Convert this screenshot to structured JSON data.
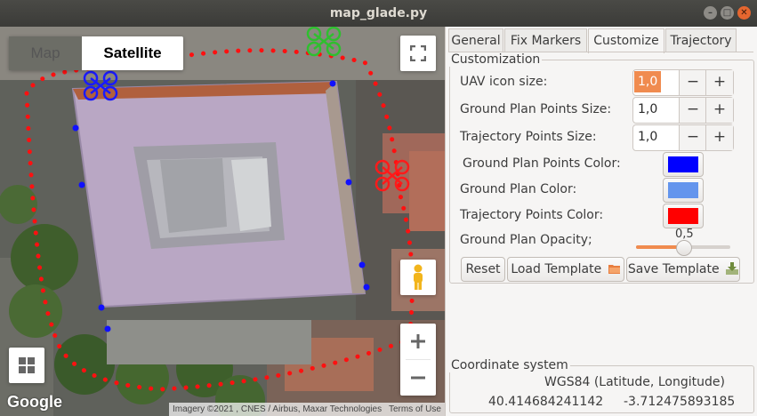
{
  "window": {
    "title": "map_glade.py"
  },
  "map": {
    "type_map": "Map",
    "type_satellite": "Satellite",
    "google_logo": "Google",
    "imagery_credit": "Imagery ©2021 , CNES / Airbus, Maxar Technologies",
    "terms": "Terms of Use",
    "markers": {
      "uav_green": "#2fbf2f",
      "uav_blue": "#1a1aff",
      "uav_red": "#ff1a1a",
      "ground_plan_point_color": "#1010ff",
      "trajectory_point_color": "#ff0000"
    }
  },
  "tabs": [
    {
      "label": "General",
      "active": false
    },
    {
      "label": "Fix Markers",
      "active": false
    },
    {
      "label": "Customize",
      "active": true
    },
    {
      "label": "Trajectory",
      "active": false
    }
  ],
  "customization": {
    "frame_label": "Customization",
    "uav_icon_size": {
      "label": "UAV icon size:",
      "value": "1,0"
    },
    "ground_plan_points_size": {
      "label": "Ground Plan Points Size:",
      "value": "1,0"
    },
    "trajectory_points_size": {
      "label": "Trajectory Points Size:",
      "value": "1,0"
    },
    "ground_plan_points_color": {
      "label": "Ground Plan Points Color:",
      "color": "#0000ff"
    },
    "ground_plan_color": {
      "label": "Ground Plan Color:",
      "color": "#6495ed"
    },
    "trajectory_points_color": {
      "label": "Trajectory Points Color:",
      "color": "#ff0000"
    },
    "ground_plan_opacity": {
      "label": "Ground Plan Opacity;",
      "value": "0,5",
      "fraction": 0.5
    },
    "buttons": {
      "reset": "Reset",
      "load_template": "Load Template",
      "save_template": "Save Template"
    },
    "minus": "−",
    "plus": "+"
  },
  "coordinate_system": {
    "frame_label": "Coordinate system",
    "name": "WGS84 (Latitude, Longitude)",
    "latitude": "40.414684241142",
    "longitude": "-3.712475893185"
  }
}
